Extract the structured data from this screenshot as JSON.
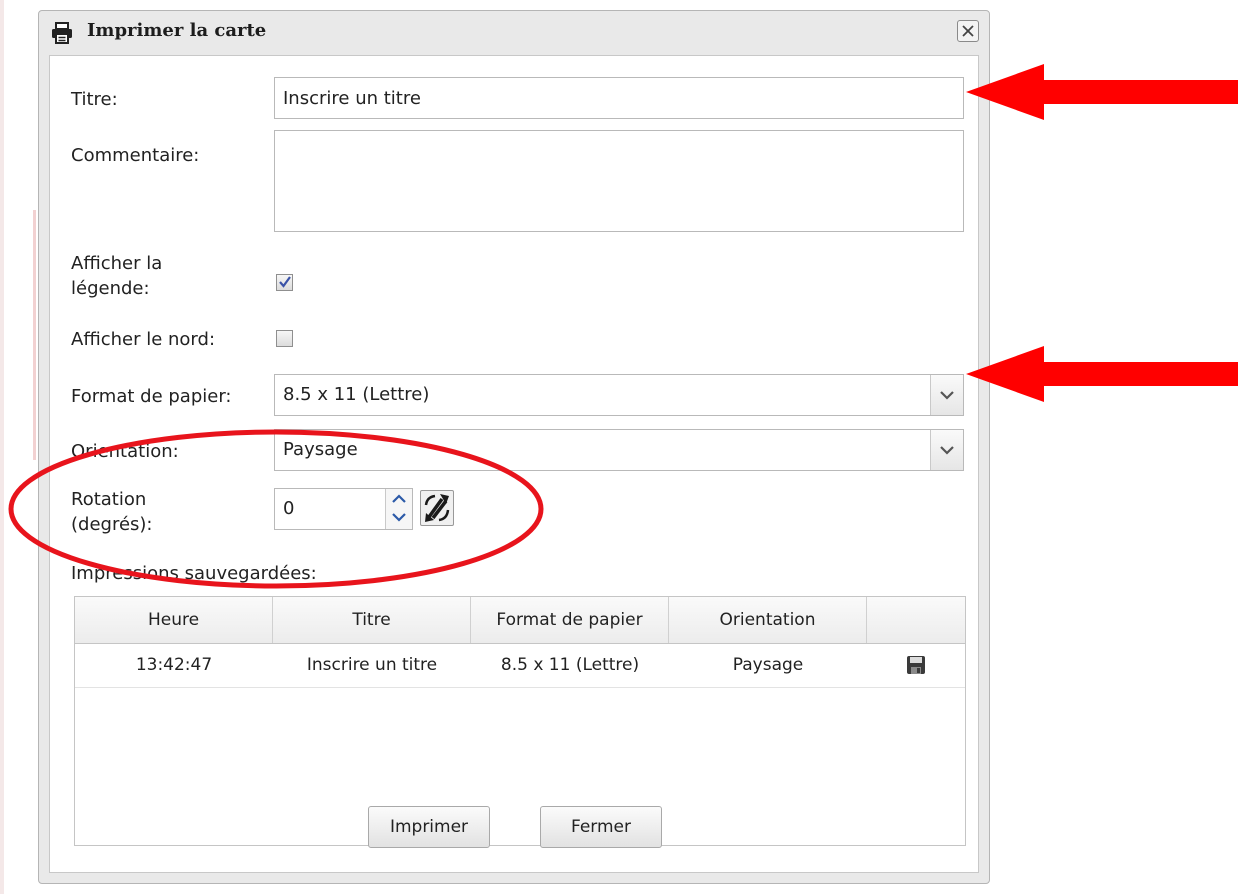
{
  "dialog": {
    "title": "Imprimer la carte"
  },
  "form": {
    "title_label": "Titre:",
    "title_value": "Inscrire un titre",
    "comment_label": "Commentaire:",
    "comment_value": "",
    "legend_label_line1": "Afficher la",
    "legend_label_line2": "légende:",
    "legend_checked": true,
    "north_label": "Afficher le nord:",
    "north_checked": false,
    "paper_label": "Format de papier:",
    "paper_value": "8.5 x 11 (Lettre)",
    "orientation_label": "Orientation:",
    "orientation_value": "Paysage",
    "rotation_label_line1": "Rotation",
    "rotation_label_line2": "(degrés):",
    "rotation_value": "0",
    "saved_label": "Impressions sauvegardées:"
  },
  "grid": {
    "headers": [
      "Heure",
      "Titre",
      "Format de papier",
      "Orientation",
      ""
    ],
    "rows": [
      {
        "time": "13:42:47",
        "title": "Inscrire un titre",
        "paper": "8.5 x 11 (Lettre)",
        "orientation": "Paysage",
        "action_icon": "save-icon"
      }
    ]
  },
  "buttons": {
    "print": "Imprimer",
    "close": "Fermer"
  },
  "annotations": {
    "arrow_color": "#ff0000",
    "ellipse_color": "#e8141c"
  }
}
